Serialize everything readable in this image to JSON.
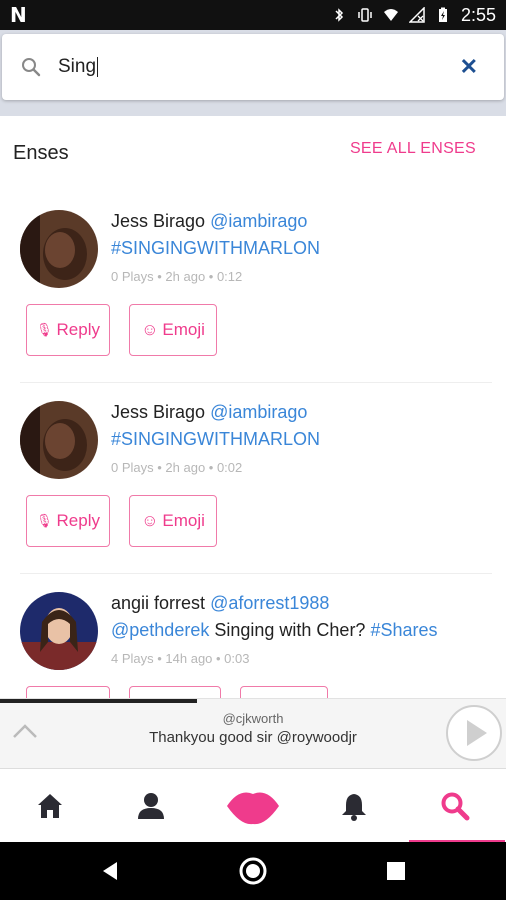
{
  "status_bar": {
    "time": "2:55"
  },
  "search": {
    "value": "Sing"
  },
  "section": {
    "title": "Enses",
    "see_all": "SEE ALL ENSES"
  },
  "posts": [
    {
      "name": "Jess Birago",
      "handle": "@iambirago",
      "text": "",
      "tag": "#SINGINGWITHMARLON",
      "meta": "0 Plays • 2h ago • 0:12",
      "reply": "Reply",
      "emoji": "Emoji"
    },
    {
      "name": "Jess Birago",
      "handle": "@iambirago",
      "text": "",
      "tag": "#SINGINGWITHMARLON",
      "meta": "0 Plays • 2h ago • 0:02",
      "reply": "Reply",
      "emoji": "Emoji"
    },
    {
      "name": "angii forrest",
      "handle": "@aforrest1988",
      "mention": "@pethderek",
      "text": "Singing with Cher?",
      "tag": "#Shares",
      "meta": "4 Plays • 14h ago • 0:03"
    }
  ],
  "player": {
    "user": "@cjkworth",
    "message": "Thankyou good sir @roywoodjr",
    "progress": 0.39
  },
  "tabs": [
    {
      "icon": "home-icon"
    },
    {
      "icon": "profile-icon"
    },
    {
      "icon": "lips-icon"
    },
    {
      "icon": "bell-icon"
    },
    {
      "icon": "search-icon",
      "active": true
    }
  ],
  "colors": {
    "accent": "#ef3b8c",
    "link": "#3a86d8",
    "clear": "#1d4f91"
  }
}
